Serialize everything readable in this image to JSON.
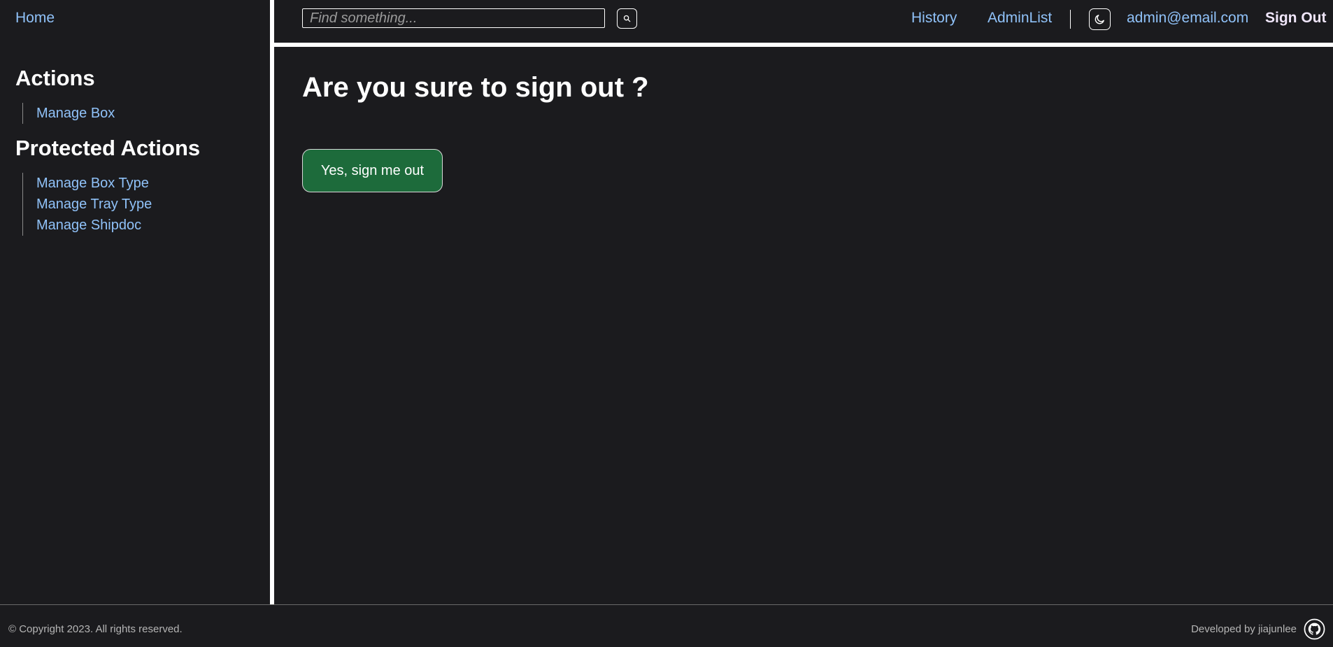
{
  "sidebar": {
    "home_label": "Home",
    "sections": [
      {
        "title": "Actions",
        "items": [
          "Manage Box"
        ]
      },
      {
        "title": "Protected Actions",
        "items": [
          "Manage Box Type",
          "Manage Tray Type",
          "Manage Shipdoc"
        ]
      }
    ]
  },
  "header": {
    "search_placeholder": "Find something...",
    "search_icon": "search-icon",
    "links": {
      "history": "History",
      "admin_list": "AdminList"
    },
    "theme_icon": "moon-icon",
    "user_email": "admin@email.com",
    "sign_out_label": "Sign Out"
  },
  "main": {
    "title": "Are you sure to sign out ?",
    "confirm_label": "Yes, sign me out"
  },
  "footer": {
    "copyright": "© Copyright 2023. All rights reserved.",
    "developed_by": "Developed by jiajunlee",
    "github_icon": "github-icon"
  },
  "colors": {
    "background": "#1b1b1e",
    "link": "#90c2f9",
    "confirm_button": "#1d6b3b",
    "text": "#ffffff"
  }
}
